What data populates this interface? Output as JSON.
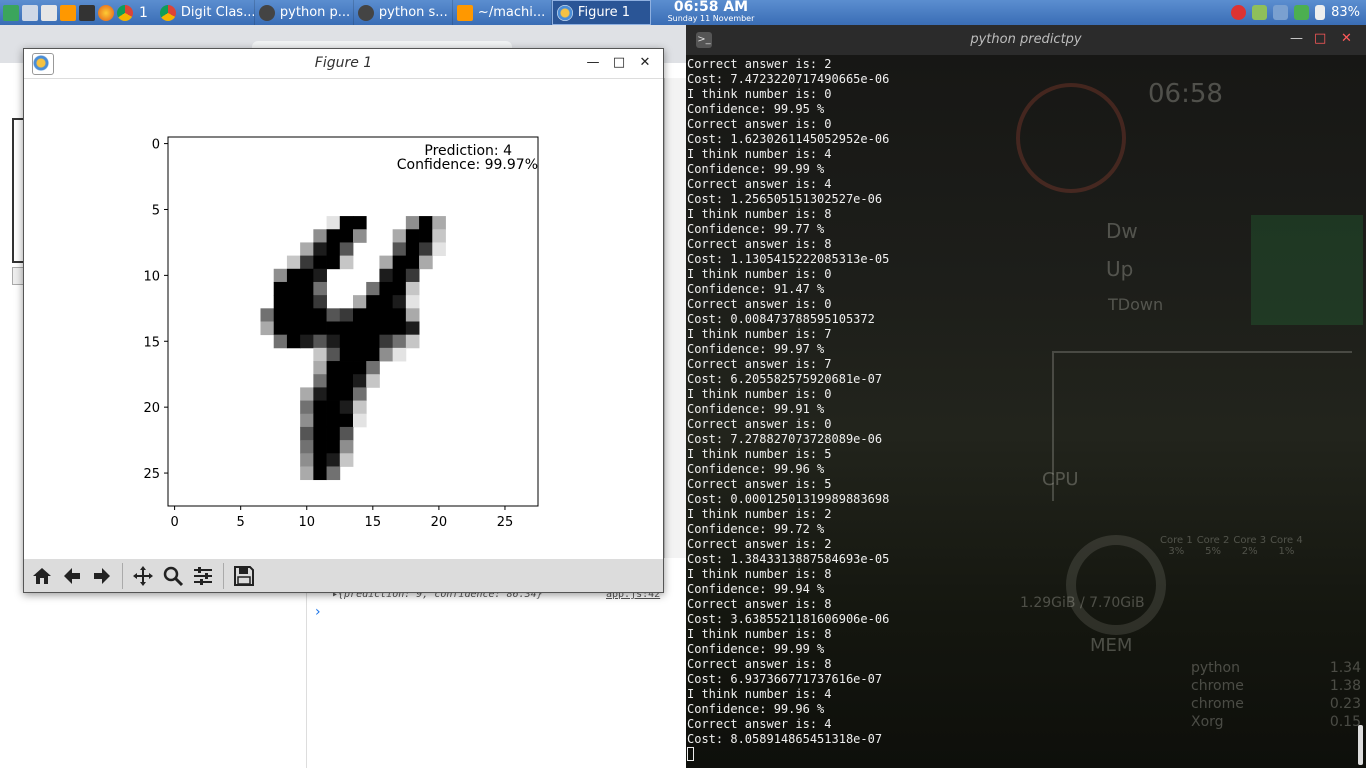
{
  "taskbar": {
    "workspace": "1",
    "tasks": [
      {
        "label": "Digit Clas...",
        "icon": "chrome-icon"
      },
      {
        "label": "python p...",
        "icon": "terminal-icon"
      },
      {
        "label": "python s...",
        "icon": "terminal-icon"
      },
      {
        "label": "~/machi...",
        "icon": "sublime-icon"
      },
      {
        "label": "Figure 1",
        "icon": "matplotlib-icon"
      }
    ],
    "clock_time": "06:58 AM",
    "clock_date": "Sunday 11 November",
    "battery": "83%"
  },
  "background": {
    "devtools_log": "▸{prediction: 9, confidence: 86.34}",
    "devtools_link": "app.js:42"
  },
  "figure": {
    "title": "Figure 1",
    "annotation": {
      "prediction": "Prediction: 4",
      "confidence": "Confidence: 99.97%"
    },
    "toolbar": {
      "home": "home-icon",
      "back": "back-arrow-icon",
      "forward": "forward-arrow-icon",
      "pan": "pan-icon",
      "zoom": "zoom-icon",
      "configure": "configure-subplots-icon",
      "save": "save-icon"
    }
  },
  "chart_data": {
    "type": "heatmap",
    "colormap": "gray_r",
    "grid": false,
    "x_ticks": [
      "0",
      "5",
      "10",
      "15",
      "20",
      "25"
    ],
    "y_ticks": [
      "0",
      "5",
      "10",
      "15",
      "20",
      "25"
    ],
    "xlim": [
      -0.5,
      27.5
    ],
    "ylim": [
      27.5,
      -0.5
    ],
    "pixels": [
      "............................",
      "............................",
      "............................",
      "............................",
      "............................",
      "............................",
      "..................fb.ob.....",
      "..................mb.ib.d...",
      "...................ib.o.b...",
      "...................kb..m....",
      "..................lk...i....",
      "..................pb...h....",
      "..................i...hb....",
      "..................jb...p....",
      "...................e..q.....",
      "...................o........",
      "....................g.......",
      "....................h.......",
      "....................m.......",
      "....................m.......",
      "....................p.......",
      "....................j.......",
      "............................",
      "............................",
      "............................",
      "............................",
      "............................",
      "............................"
    ],
    "digit_image": [
      [
        [
          12,
          6,
          1
        ],
        [
          13,
          6,
          9
        ],
        [
          14,
          6,
          9
        ],
        [
          18,
          6,
          4
        ],
        [
          19,
          6,
          9
        ],
        [
          20,
          6,
          3
        ]
      ],
      [
        [
          11,
          7,
          4
        ],
        [
          12,
          7,
          9
        ],
        [
          13,
          7,
          9
        ],
        [
          14,
          7,
          4
        ],
        [
          17,
          7,
          3
        ],
        [
          18,
          7,
          9
        ],
        [
          19,
          7,
          9
        ],
        [
          20,
          7,
          2
        ]
      ],
      [
        [
          10,
          8,
          3
        ],
        [
          11,
          8,
          8
        ],
        [
          12,
          8,
          9
        ],
        [
          13,
          8,
          6
        ],
        [
          17,
          8,
          6
        ],
        [
          18,
          8,
          9
        ],
        [
          19,
          8,
          7
        ],
        [
          20,
          8,
          1
        ]
      ],
      [
        [
          9,
          9,
          2
        ],
        [
          10,
          9,
          7
        ],
        [
          11,
          9,
          9
        ],
        [
          12,
          9,
          9
        ],
        [
          13,
          9,
          2
        ],
        [
          16,
          9,
          3
        ],
        [
          17,
          9,
          9
        ],
        [
          18,
          9,
          9
        ],
        [
          19,
          9,
          3
        ]
      ],
      [
        [
          8,
          10,
          4
        ],
        [
          9,
          10,
          9
        ],
        [
          10,
          10,
          9
        ],
        [
          11,
          10,
          8
        ],
        [
          16,
          10,
          8
        ],
        [
          17,
          10,
          9
        ],
        [
          18,
          10,
          7
        ]
      ],
      [
        [
          8,
          11,
          9
        ],
        [
          9,
          11,
          9
        ],
        [
          10,
          11,
          9
        ],
        [
          11,
          11,
          5
        ],
        [
          15,
          11,
          5
        ],
        [
          16,
          11,
          9
        ],
        [
          17,
          11,
          9
        ],
        [
          18,
          11,
          2
        ]
      ],
      [
        [
          8,
          12,
          9
        ],
        [
          9,
          12,
          9
        ],
        [
          10,
          12,
          9
        ],
        [
          11,
          12,
          7
        ],
        [
          14,
          12,
          3
        ],
        [
          15,
          12,
          9
        ],
        [
          16,
          12,
          9
        ],
        [
          17,
          12,
          8
        ],
        [
          18,
          12,
          1
        ]
      ],
      [
        [
          7,
          13,
          5
        ],
        [
          8,
          13,
          9
        ],
        [
          9,
          13,
          9
        ],
        [
          10,
          13,
          9
        ],
        [
          11,
          13,
          9
        ],
        [
          12,
          13,
          6
        ],
        [
          13,
          13,
          7
        ],
        [
          14,
          13,
          9
        ],
        [
          15,
          13,
          9
        ],
        [
          16,
          13,
          9
        ],
        [
          17,
          13,
          9
        ],
        [
          18,
          13,
          3
        ]
      ],
      [
        [
          7,
          14,
          3
        ],
        [
          8,
          14,
          9
        ],
        [
          9,
          14,
          9
        ],
        [
          10,
          14,
          9
        ],
        [
          11,
          14,
          9
        ],
        [
          12,
          14,
          9
        ],
        [
          13,
          14,
          9
        ],
        [
          14,
          14,
          9
        ],
        [
          15,
          14,
          9
        ],
        [
          16,
          14,
          9
        ],
        [
          17,
          14,
          9
        ],
        [
          18,
          14,
          8
        ]
      ],
      [
        [
          8,
          15,
          5
        ],
        [
          9,
          15,
          9
        ],
        [
          10,
          15,
          8
        ],
        [
          11,
          15,
          6
        ],
        [
          12,
          15,
          8
        ],
        [
          13,
          15,
          9
        ],
        [
          14,
          15,
          9
        ],
        [
          15,
          15,
          9
        ],
        [
          16,
          15,
          7
        ],
        [
          17,
          15,
          5
        ],
        [
          18,
          15,
          2
        ]
      ],
      [
        [
          11,
          16,
          2
        ],
        [
          12,
          16,
          6
        ],
        [
          13,
          16,
          9
        ],
        [
          14,
          16,
          9
        ],
        [
          15,
          16,
          9
        ],
        [
          16,
          16,
          4
        ],
        [
          17,
          16,
          1
        ]
      ],
      [
        [
          11,
          17,
          3
        ],
        [
          12,
          17,
          9
        ],
        [
          13,
          17,
          9
        ],
        [
          14,
          17,
          9
        ],
        [
          15,
          17,
          5
        ]
      ],
      [
        [
          11,
          18,
          5
        ],
        [
          12,
          18,
          9
        ],
        [
          13,
          18,
          9
        ],
        [
          14,
          18,
          8
        ],
        [
          15,
          18,
          2
        ]
      ],
      [
        [
          10,
          19,
          3
        ],
        [
          11,
          19,
          8
        ],
        [
          12,
          19,
          9
        ],
        [
          13,
          19,
          9
        ],
        [
          14,
          19,
          5
        ]
      ],
      [
        [
          10,
          20,
          5
        ],
        [
          11,
          20,
          9
        ],
        [
          12,
          20,
          9
        ],
        [
          13,
          20,
          8
        ],
        [
          14,
          20,
          2
        ]
      ],
      [
        [
          10,
          21,
          4
        ],
        [
          11,
          21,
          9
        ],
        [
          12,
          21,
          9
        ],
        [
          13,
          21,
          9
        ],
        [
          14,
          21,
          1
        ]
      ],
      [
        [
          10,
          22,
          6
        ],
        [
          11,
          22,
          9
        ],
        [
          12,
          22,
          9
        ],
        [
          13,
          22,
          6
        ]
      ],
      [
        [
          10,
          23,
          5
        ],
        [
          11,
          23,
          9
        ],
        [
          12,
          23,
          9
        ],
        [
          13,
          23,
          4
        ]
      ],
      [
        [
          10,
          24,
          4
        ],
        [
          11,
          24,
          9
        ],
        [
          12,
          24,
          8
        ],
        [
          13,
          24,
          2
        ]
      ],
      [
        [
          10,
          25,
          3
        ],
        [
          11,
          25,
          9
        ],
        [
          12,
          25,
          5
        ]
      ]
    ]
  },
  "terminal": {
    "title": "python predictpy",
    "lines": [
      "Correct answer is: 2",
      "Cost: 7.4723220717490665e-06",
      "I think number is: 0",
      "Confidence: 99.95 %",
      "Correct answer is: 0",
      "Cost: 1.6230261145052952e-06",
      "I think number is: 4",
      "Confidence: 99.99 %",
      "Correct answer is: 4",
      "Cost: 1.256505151302527e-06",
      "I think number is: 8",
      "Confidence: 99.77 %",
      "Correct answer is: 8",
      "Cost: 1.1305415222085313e-05",
      "I think number is: 0",
      "Confidence: 91.47 %",
      "Correct answer is: 0",
      "Cost: 0.008473788595105372",
      "I think number is: 7",
      "Confidence: 99.97 %",
      "Correct answer is: 7",
      "Cost: 6.205582575920681e-07",
      "I think number is: 0",
      "Confidence: 99.91 %",
      "Correct answer is: 0",
      "Cost: 7.278827073728089e-06",
      "I think number is: 5",
      "Confidence: 99.96 %",
      "Correct answer is: 5",
      "Cost: 0.00012501319989883698",
      "I think number is: 2",
      "Confidence: 99.72 %",
      "Correct answer is: 2",
      "Cost: 1.3843313887584693e-05",
      "I think number is: 8",
      "Confidence: 99.94 %",
      "Correct answer is: 8",
      "Cost: 3.6385521181606906e-06",
      "I think number is: 8",
      "Confidence: 99.99 %",
      "Correct answer is: 8",
      "Cost: 6.937366771737616e-07",
      "I think number is: 4",
      "Confidence: 99.96 %",
      "Correct answer is: 4",
      "Cost: 8.058914865451318e-07"
    ]
  },
  "conky": {
    "time": "06:58",
    "dw": "Dw",
    "up": "Up",
    "tdown": "TDown",
    "cpu": "CPU",
    "cores": [
      {
        "name": "Core 1",
        "value": "3%"
      },
      {
        "name": "Core 2",
        "value": "5%"
      },
      {
        "name": "Core 3",
        "value": "2%"
      },
      {
        "name": "Core 4",
        "value": "1%"
      }
    ],
    "mem_usage": "1.29GiB / 7.70GiB",
    "mem": "MEM",
    "processes": [
      {
        "name": "python",
        "value": "1.34"
      },
      {
        "name": "chrome",
        "value": "1.38"
      },
      {
        "name": "chrome",
        "value": "0.23"
      },
      {
        "name": "Xorg",
        "value": "0.15"
      }
    ]
  }
}
